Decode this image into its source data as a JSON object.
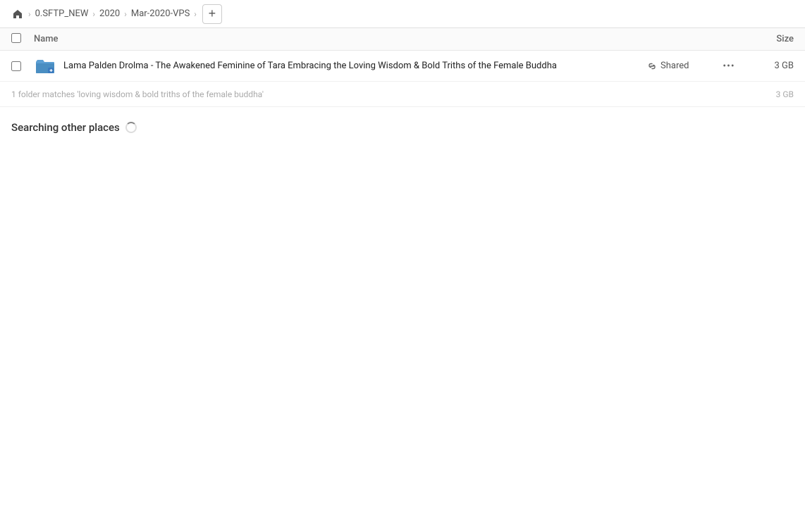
{
  "toolbar": {
    "home_icon": "🏠",
    "breadcrumbs": [
      {
        "label": "0.SFTP_NEW"
      },
      {
        "label": "2020"
      },
      {
        "label": "Mar-2020-VPS"
      }
    ],
    "add_button_label": "+"
  },
  "columns": {
    "name_label": "Name",
    "size_label": "Size"
  },
  "file_row": {
    "name": "Lama Palden Drolma - The Awakened Feminine of Tara Embracing the Loving Wisdom & Bold Triths of the Female Buddha",
    "shared_label": "Shared",
    "more_icon": "···",
    "size": "3 GB"
  },
  "info_row": {
    "text": "1 folder matches 'loving wisdom & bold triths of the female buddha'",
    "size": "3 GB"
  },
  "searching_section": {
    "label": "Searching other places"
  },
  "colors": {
    "folder_icon_bg": "#4a90d9",
    "folder_icon_body": "#5ba0e8",
    "link_icon": "#777"
  }
}
